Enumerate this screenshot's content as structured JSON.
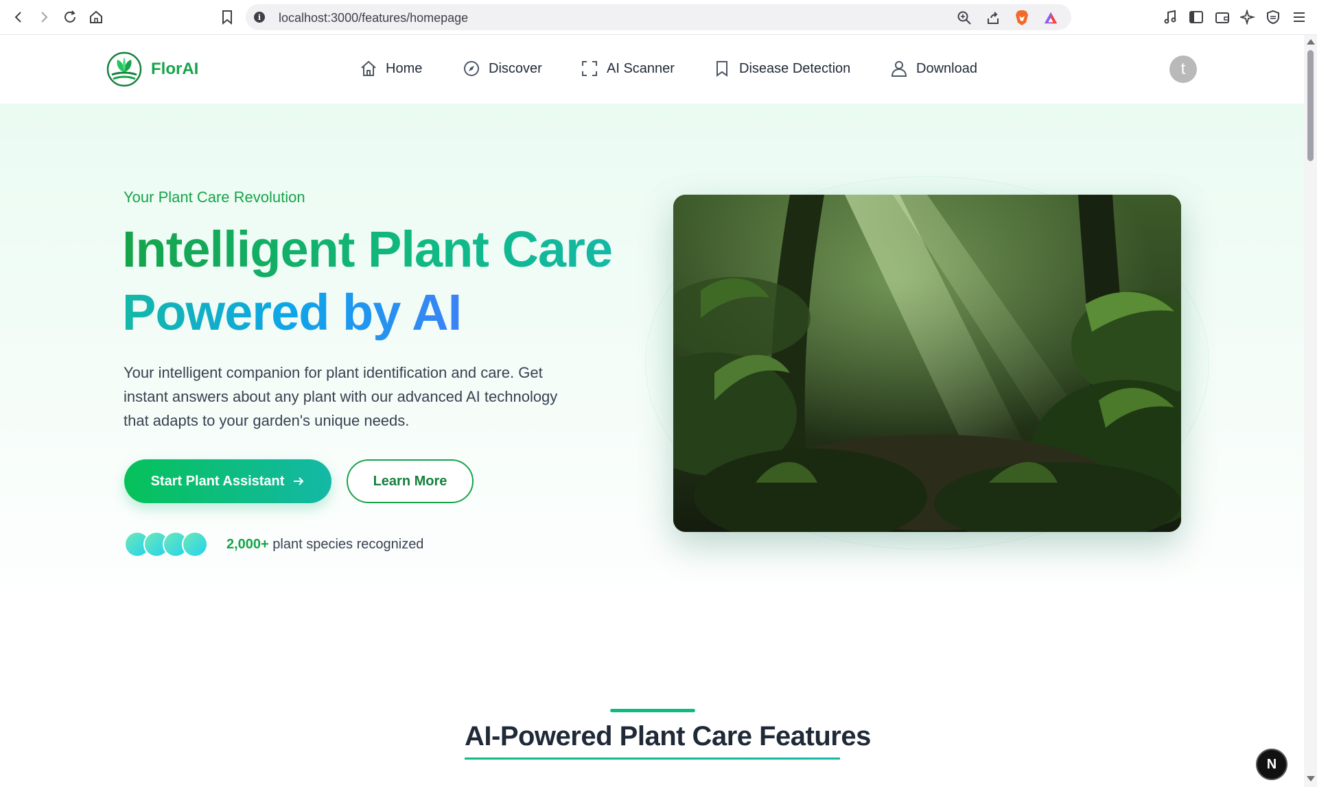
{
  "browser": {
    "url": "localhost:3000/features/homepage"
  },
  "header": {
    "brand": "FlorAI",
    "nav": [
      {
        "label": "Home",
        "icon": "home-icon"
      },
      {
        "label": "Discover",
        "icon": "compass-icon"
      },
      {
        "label": "AI Scanner",
        "icon": "scan-icon"
      },
      {
        "label": "Disease Detection",
        "icon": "bookmark-icon"
      },
      {
        "label": "Download",
        "icon": "user-icon"
      }
    ],
    "avatar_initial": "t"
  },
  "hero": {
    "eyebrow": "Your Plant Care Revolution",
    "headline_line1": "Intelligent Plant Care",
    "headline_line2": "Powered by AI",
    "description": "Your intelligent companion for plant identification and care. Get instant answers about any plant with our advanced AI technology that adapts to your garden's unique needs.",
    "primary_button": "Start Plant Assistant",
    "secondary_button": "Learn More",
    "stat_value": "2,000+",
    "stat_text": "plant species recognized"
  },
  "features": {
    "title": "AI-Powered Plant Care Features"
  },
  "dev_badge": "N",
  "colors": {
    "brand_green": "#16a34a",
    "accent_teal": "#14b8a6",
    "accent_blue": "#3b82f6"
  }
}
